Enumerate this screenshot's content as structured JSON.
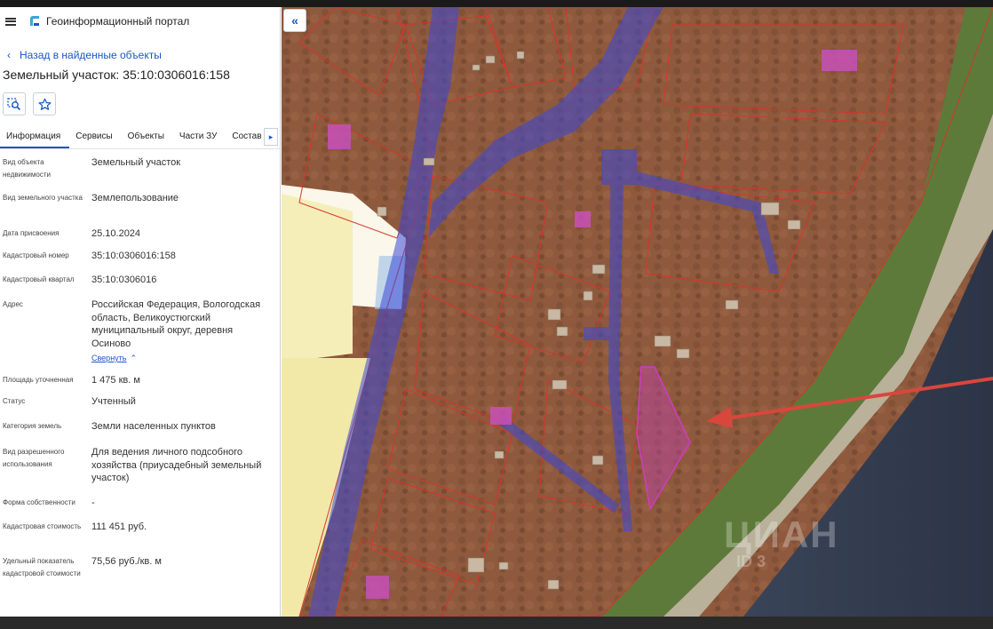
{
  "app": {
    "title": "Геоинформационный портал"
  },
  "nav": {
    "back_label": "Назад в найденные объекты"
  },
  "object": {
    "title": "Земельный участок: 35:10:0306016:158"
  },
  "tabs": [
    {
      "label": "Информация",
      "active": true
    },
    {
      "label": "Сервисы",
      "active": false
    },
    {
      "label": "Объекты",
      "active": false
    },
    {
      "label": "Части ЗУ",
      "active": false
    },
    {
      "label": "Состав",
      "active": false
    }
  ],
  "attributes": {
    "object_type": {
      "label": "Вид объекта недвижимости",
      "value": "Земельный участок"
    },
    "land_type": {
      "label": "Вид земельного участка",
      "value": "Землепользование"
    },
    "assigned_date": {
      "label": "Дата присвоения",
      "value": "25.10.2024"
    },
    "cadastral_number": {
      "label": "Кадастровый номер",
      "value": "35:10:0306016:158"
    },
    "cadastral_quarter": {
      "label": "Кадастровый квартал",
      "value": "35:10:0306016"
    },
    "address": {
      "label": "Адрес",
      "value": "Российская Федерация, Вологодская область, Великоустюгский муниципальный округ, деревня Осиново",
      "collapse_label": "Свернуть"
    },
    "area": {
      "label": "Площадь уточненная",
      "value": "1 475 кв. м"
    },
    "status": {
      "label": "Статус",
      "value": "Учтенный"
    },
    "land_category": {
      "label": "Категория земель",
      "value": "Земли населенных пунктов"
    },
    "permitted_use": {
      "label": "Вид разрешенного использования",
      "value": "Для ведения личного подсобного хозяйства (приусадебный земельный участок)"
    },
    "ownership": {
      "label": "Форма собственности",
      "value": "-"
    },
    "cadastral_value": {
      "label": "Кадастровая стоимость",
      "value": "111 451 руб."
    },
    "specific_value": {
      "label": "Удельный показатель кадастровой стоимости",
      "value": "75,56 руб./кв. м"
    }
  },
  "map": {
    "watermark": "ЦИАН",
    "watermark_sub": "ID 3"
  },
  "colors": {
    "accent": "#1a56c8",
    "parcel_outline": "#d9342b",
    "selected_parcel": "#c040b0",
    "road_overlay": "#3a48d8",
    "arrow": "#d8473c"
  }
}
